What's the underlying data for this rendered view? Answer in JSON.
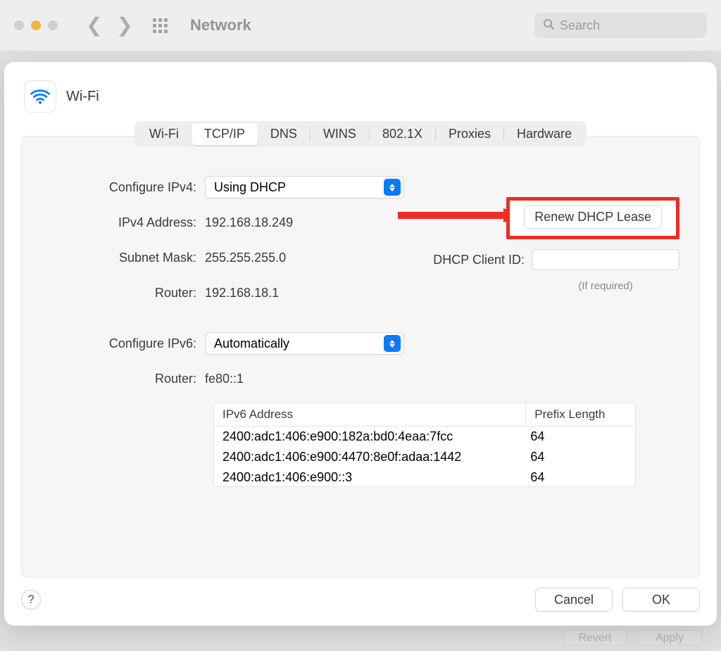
{
  "window": {
    "title": "Network",
    "search_placeholder": "Search"
  },
  "sheet": {
    "title": "Wi-Fi",
    "tabs": [
      "Wi-Fi",
      "TCP/IP",
      "DNS",
      "WINS",
      "802.1X",
      "Proxies",
      "Hardware"
    ],
    "active_tab_index": 1
  },
  "ipv4": {
    "configure_label": "Configure IPv4:",
    "configure_value": "Using DHCP",
    "address_label": "IPv4 Address:",
    "address_value": "192.168.18.249",
    "subnet_label": "Subnet Mask:",
    "subnet_value": "255.255.255.0",
    "router_label": "Router:",
    "router_value": "192.168.18.1"
  },
  "dhcp": {
    "renew_label": "Renew DHCP Lease",
    "client_id_label": "DHCP Client ID:",
    "if_required": "(If required)"
  },
  "ipv6": {
    "configure_label": "Configure IPv6:",
    "configure_value": "Automatically",
    "router_label": "Router:",
    "router_value": "fe80::1",
    "table": {
      "headers": [
        "IPv6 Address",
        "Prefix Length"
      ],
      "rows": [
        {
          "addr": "2400:adc1:406:e900:182a:bd0:4eaa:7fcc",
          "prefix": "64"
        },
        {
          "addr": "2400:adc1:406:e900:4470:8e0f:adaa:1442",
          "prefix": "64"
        },
        {
          "addr": "2400:adc1:406:e900::3",
          "prefix": "64"
        }
      ]
    }
  },
  "footer": {
    "help": "?",
    "cancel": "Cancel",
    "ok": "OK"
  },
  "backdrop_buttons": {
    "revert": "Revert",
    "apply": "Apply"
  }
}
